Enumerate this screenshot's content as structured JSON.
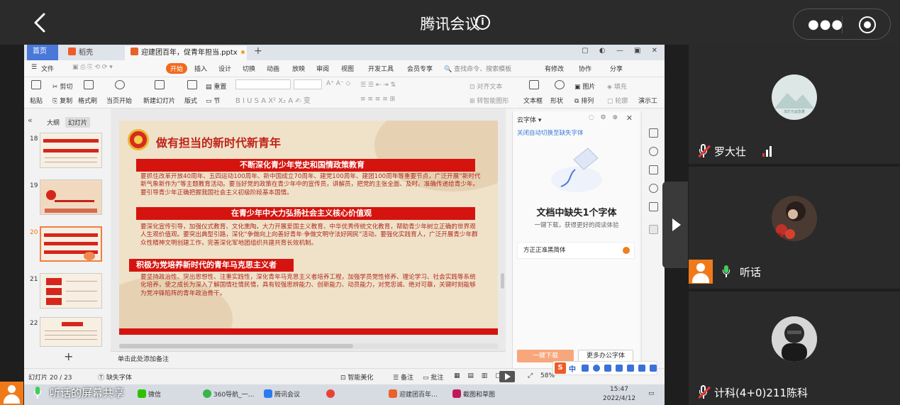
{
  "meeting": {
    "title": "腾讯会议",
    "more_icon": "more-dots-icon",
    "record_icon": "record-icon"
  },
  "wps": {
    "tabs": {
      "home": "首页",
      "daoke": "稻壳",
      "doc": "迎建团百年，促青年担当.pptx"
    },
    "menus": [
      "文件",
      "开始",
      "插入",
      "设计",
      "切换",
      "动画",
      "放映",
      "审阅",
      "视图",
      "开发工具",
      "会员专享"
    ],
    "search_placeholder": "查找命令、搜索模板",
    "right_menus": [
      "有修改",
      "协作",
      "分享"
    ],
    "ribbon": {
      "cut": "剪切",
      "paste": "粘贴",
      "copy": "复制",
      "format_painter": "格式刷",
      "from_current": "当页开始",
      "new_slide": "新建幻灯片",
      "layout": "版式",
      "section": "节",
      "reset": "重置",
      "textbox": "文本框",
      "shape": "形状",
      "image": "图片",
      "fill": "填充",
      "arrange": "排列",
      "outline": "轮廓",
      "text_tools": "对齐文本",
      "convert": "转智能图形",
      "present": "演示工"
    },
    "sidebar": {
      "tabs": [
        "大纲",
        "幻灯片"
      ],
      "slides": [
        "18",
        "19",
        "20",
        "21",
        "22"
      ]
    },
    "slide": {
      "title": "做有担当的新时代新青年",
      "sections": [
        {
          "heading": "不断深化青少年党史和国情政策教育",
          "body": "要抓住改革开放40周年、五四运动100周年、新中国成立70周年、建党100周年、建团100周年等重要节点，广泛开展“新时代新气象新作为”等主题教育活动。要当好党的政策在青少年中的宣传员，讲解员，把党的主张全面、及时、准确传递给青少年。要引导青少年正确把握我国社会主义初级阶段基本国情。"
        },
        {
          "heading": "在青少年中大力弘扬社会主义核心价值观",
          "body": "要深化宣传引导，加强仪式教育、文化熏陶，大力开展爱国主义教育、中华优秀传统文化教育，帮助青少年树立正确的世界观人生观价值观。要突出典型引路，深化“争做向上向善好青年·争做文明守法好网民”活动。要强化实践育人，广泛开展青少年群众性精神文明创建工作，完善深化军地团组织共建共育长效机制。"
        },
        {
          "heading": "积极为党培养新时代的青年马克思主义者",
          "body": "要坚持政治性、突出思想性、注重实践性，深化青年马克思主义者培养工程，加强学员党性修养、理论学习、社会实践等系统化培养，使之成长为深入了解国情社情民情，具有较强思辨能力、创新能力、动员能力，对党忠诚、绝对可靠，关键时刻能够为党冲锋陷阵的青年政治骨干。"
        }
      ]
    },
    "notes_hint": "单击此处添加备注",
    "font_panel": {
      "header": "云字体",
      "link": "关闭自动切换至缺失字体",
      "title": "文档中缺失1个字体",
      "subtitle": "一键下载，获得更好的阅读体验",
      "font_item": "方正正准黑简体",
      "btn_download": "一键下载",
      "btn_more": "更多办公字体"
    },
    "status": {
      "slide_count": "幻灯片 20 / 23",
      "missing_font": "缺失字体",
      "smart": "智能美化",
      "notes": "备注",
      "comments": "批注",
      "zoom": "58%"
    },
    "ime": {
      "label": "中"
    }
  },
  "taskbar": {
    "items": [
      "微信",
      "360导航_一…",
      "腾讯会议",
      "",
      "迎建团百年…",
      "截图和草图"
    ],
    "time": "15:47",
    "date": "2022/4/12"
  },
  "share_label": "听话的屏幕共享",
  "participants": [
    {
      "name": "罗大壮",
      "mic": "muted",
      "avatar_caption": "加灯元运急着"
    },
    {
      "name": "听话",
      "mic": "on"
    },
    {
      "name": "计科(4+0)211陈科",
      "mic": "muted"
    }
  ],
  "colors": {
    "accent": "#f06a1d",
    "slide_red": "#d5140f",
    "title_red": "#c0231a",
    "wps_blue": "#4a78d8",
    "mic_green": "#3ccf5a"
  }
}
